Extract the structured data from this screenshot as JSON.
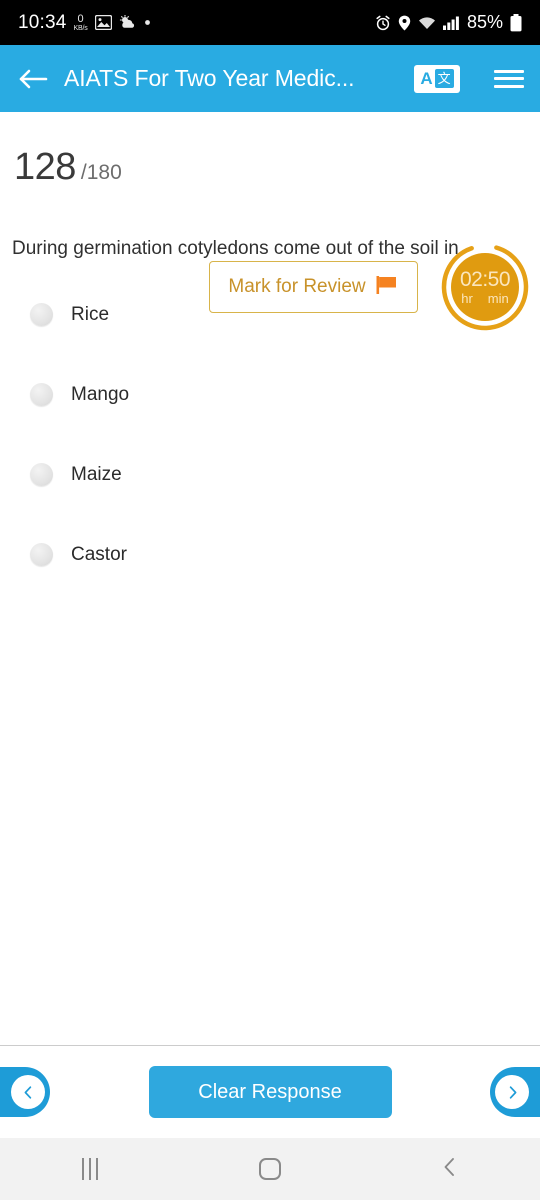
{
  "status_bar": {
    "time": "10:34",
    "net_speed_value": "0",
    "net_speed_unit": "KB/s",
    "battery_percent": "85%",
    "icons": [
      "image-icon",
      "weather-icon",
      "dot-icon",
      "alarm-icon",
      "location-icon",
      "wifi-icon",
      "signal-icon",
      "battery-icon"
    ]
  },
  "header": {
    "title": "AIATS For Two Year Medic...",
    "back_icon": "back-arrow-icon",
    "translate_icon_letter": "A",
    "translate_icon_glyph": "文",
    "menu_icon": "hamburger-menu-icon",
    "background_color": "#29ABE2"
  },
  "question_meta": {
    "current_number": "128",
    "total_separator": "/180",
    "mark_for_review_label": "Mark for Review",
    "flag_icon": "flag-icon",
    "flag_color": "#F58220",
    "accent_gold": "#c8922a"
  },
  "timer": {
    "value": "02:50",
    "unit_hours": "hr",
    "unit_minutes": "min",
    "ring_color": "#E6A117",
    "fill_color": "#E09B10",
    "text_color": "#fbe6bd"
  },
  "question": {
    "text": "During germination cotyledons come out of the soil in",
    "options": [
      {
        "label": "Rice",
        "selected": false
      },
      {
        "label": "Mango",
        "selected": false
      },
      {
        "label": "Maize",
        "selected": false
      },
      {
        "label": "Castor",
        "selected": false
      }
    ]
  },
  "action_bar": {
    "prev_icon": "chevron-left-icon",
    "next_icon": "chevron-right-icon",
    "clear_label": "Clear Response",
    "button_color": "#2FA8DE"
  },
  "system_nav": {
    "recents_icon": "recents-icon",
    "home_icon": "home-icon",
    "back_icon": "system-back-icon"
  }
}
